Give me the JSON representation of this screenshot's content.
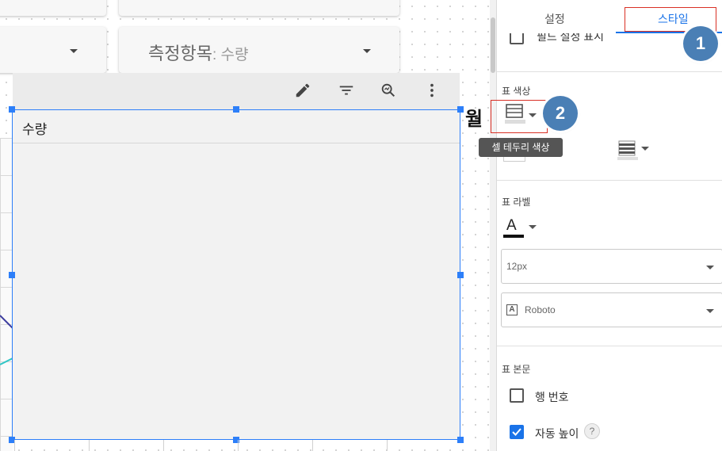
{
  "canvas": {
    "control2_label": "측정항목",
    "control2_value": ": 수량",
    "table_header": "수량",
    "side_text": "월",
    "toolbar_icons": [
      "edit-icon",
      "filter-icon",
      "zoom-icon",
      "more-vert-icon"
    ]
  },
  "panel": {
    "tabs": {
      "setup": "설정",
      "style": "스타일"
    },
    "partial_row": "필드 설정 표시",
    "table_colors": {
      "title": "표 색상",
      "tooltip": "셀 테두리 색상"
    },
    "table_labels": {
      "title": "표 라벨",
      "font_size": "12px",
      "font_family": "Roboto"
    },
    "table_body": {
      "title": "표 본문",
      "row_numbers": "행 번호",
      "auto_height": "자동 높이",
      "help": "?"
    }
  },
  "annotations": {
    "badge1": "1",
    "badge2": "2"
  },
  "colors": {
    "accent": "#1a73e8",
    "selection": "#2d7ff9",
    "badge": "#4a7fb5",
    "highlight": "#d93025"
  }
}
